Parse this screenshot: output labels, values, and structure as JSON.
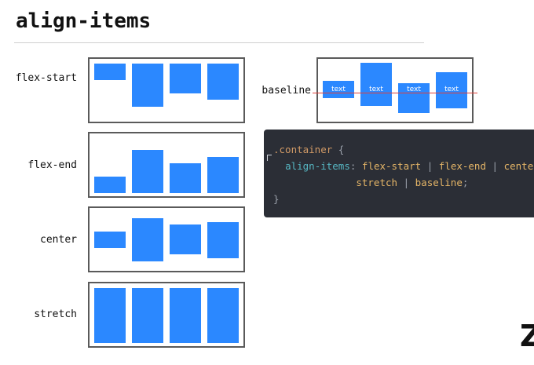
{
  "title": "align-items",
  "rows": [
    {
      "label": "flex-start"
    },
    {
      "label": "flex-end"
    },
    {
      "label": "center"
    },
    {
      "label": "stretch"
    }
  ],
  "baseline": {
    "label": "baseline",
    "items": [
      "text",
      "text",
      "text",
      "text"
    ]
  },
  "code": {
    "selector": ".container",
    "open": "{",
    "property": "align-items",
    "colon": ":",
    "values_line1": [
      "flex-start",
      "flex-end",
      "cente"
    ],
    "values_line2": [
      "stretch",
      "baseline"
    ],
    "separator": "|",
    "semicolon": ";",
    "close": "}"
  },
  "colors": {
    "item": "#2b88ff",
    "box_border": "#5a5a5a",
    "baseline_line": "#e0403a",
    "code_bg": "#2b2e36"
  },
  "corner_glyph": "Z"
}
